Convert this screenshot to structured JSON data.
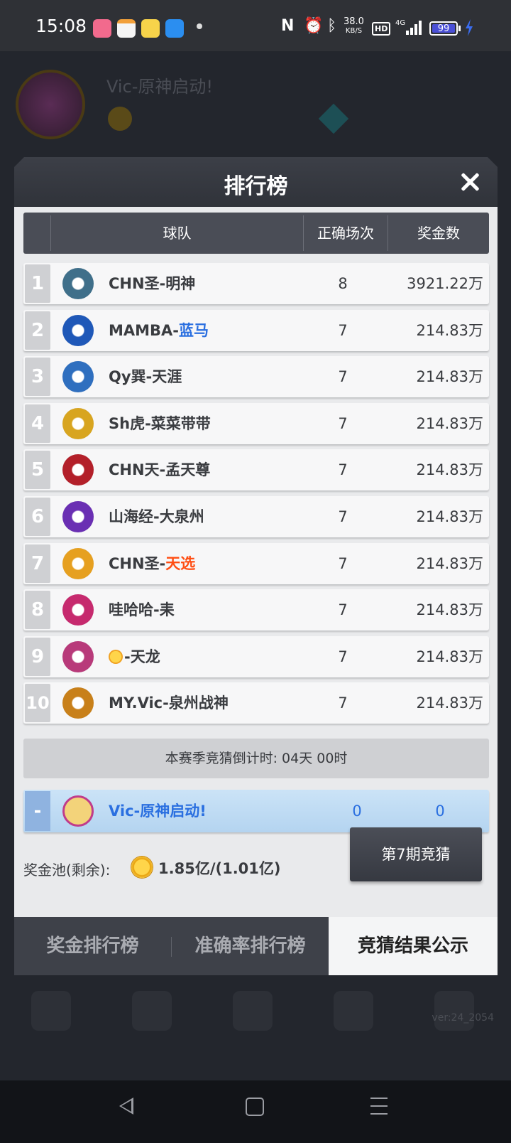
{
  "status_bar": {
    "time": "15:08",
    "net_speed_value": "38.0",
    "net_speed_unit": "KB/S",
    "hd": "HD",
    "network": "4G",
    "battery": "99",
    "icons": [
      "nfc-icon",
      "alarm-icon",
      "bluetooth-icon",
      "signal-icon",
      "battery-icon",
      "charging-icon"
    ]
  },
  "modal": {
    "title": "排行榜",
    "columns": {
      "team": "球队",
      "correct": "正确场次",
      "prize": "奖金数"
    },
    "rows": [
      {
        "rank": "1",
        "name": "CHN圣-明神",
        "name_prefix": "",
        "name_highlight": "",
        "highlight_color": "",
        "correct": "8",
        "prize": "3921.22万",
        "logo_color": "#3f6f8a"
      },
      {
        "rank": "2",
        "name": "MAMBA-",
        "name_prefix": "",
        "name_highlight": "蓝马",
        "highlight_color": "blue",
        "correct": "7",
        "prize": "214.83万",
        "logo_color": "#1f58b8"
      },
      {
        "rank": "3",
        "name": "Qy巽-天涯",
        "name_prefix": "",
        "name_highlight": "",
        "highlight_color": "",
        "correct": "7",
        "prize": "214.83万",
        "logo_color": "#2f6fbf"
      },
      {
        "rank": "4",
        "name": "Sh虎-菜菜带带",
        "name_prefix": "",
        "name_highlight": "",
        "highlight_color": "",
        "correct": "7",
        "prize": "214.83万",
        "logo_color": "#d8a520"
      },
      {
        "rank": "5",
        "name": "CHN天-孟天尊",
        "name_prefix": "",
        "name_highlight": "",
        "highlight_color": "",
        "correct": "7",
        "prize": "214.83万",
        "logo_color": "#b3202a"
      },
      {
        "rank": "6",
        "name": "山海经-大泉州",
        "name_prefix": "",
        "name_highlight": "",
        "highlight_color": "",
        "correct": "7",
        "prize": "214.83万",
        "logo_color": "#6a2fb3"
      },
      {
        "rank": "7",
        "name": "CHN圣-",
        "name_prefix": "",
        "name_highlight": "天选",
        "highlight_color": "orange",
        "correct": "7",
        "prize": "214.83万",
        "logo_color": "#e6a020"
      },
      {
        "rank": "8",
        "name": "哇哈哈-耒",
        "name_prefix": "",
        "name_highlight": "",
        "highlight_color": "",
        "correct": "7",
        "prize": "214.83万",
        "logo_color": "#c62a6e"
      },
      {
        "rank": "9",
        "name": "-天龙",
        "name_prefix": "sun",
        "name_highlight": "",
        "highlight_color": "",
        "correct": "7",
        "prize": "214.83万",
        "logo_color": "#b83a7a"
      },
      {
        "rank": "10",
        "name": "MY.Vic-泉州战神",
        "name_prefix": "",
        "name_highlight": "",
        "highlight_color": "",
        "correct": "7",
        "prize": "214.83万",
        "logo_color": "#c8801a"
      }
    ],
    "countdown": "本赛季竞猜倒计时: 04天 00时",
    "self_row": {
      "rank": "-",
      "name": "Vic-原神启动!",
      "correct": "0",
      "prize": "0"
    },
    "pool_label": "奖金池(剩余):",
    "pool_value": "1.85亿/(1.01亿)",
    "period_button": "第7期竞猜",
    "tabs": [
      {
        "label": "奖金排行榜",
        "active": false
      },
      {
        "label": "准确率排行榜",
        "active": false
      },
      {
        "label": "竞猜结果公示",
        "active": true
      }
    ]
  },
  "background": {
    "team_title": "Vic-原神启动!"
  },
  "version": "ver:24_2054"
}
